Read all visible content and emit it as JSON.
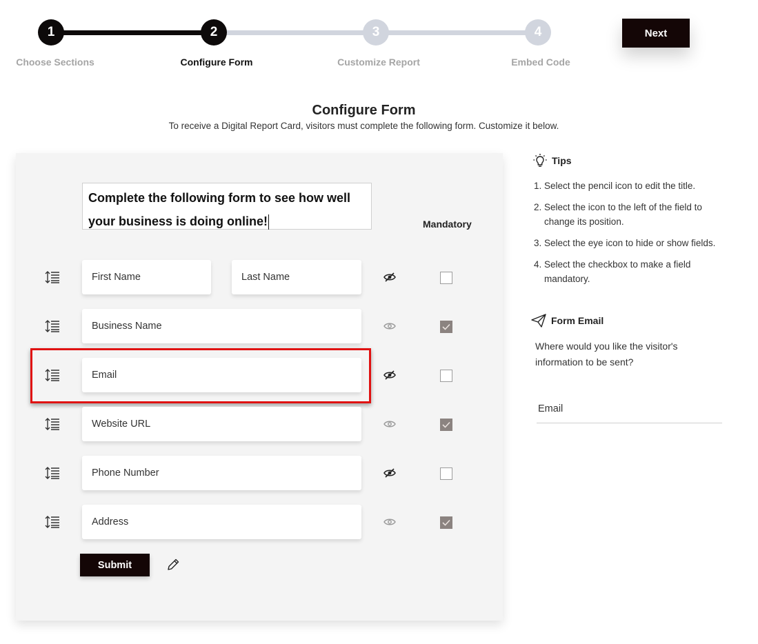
{
  "stepper": {
    "steps": [
      {
        "number": "1",
        "label": "Choose Sections",
        "state": "done"
      },
      {
        "number": "2",
        "label": "Configure Form",
        "state": "active"
      },
      {
        "number": "3",
        "label": "Customize Report",
        "state": "todo"
      },
      {
        "number": "4",
        "label": "Embed Code",
        "state": "todo"
      }
    ],
    "next_label": "Next"
  },
  "header": {
    "title": "Configure Form",
    "subtitle": "To receive a Digital Report Card, visitors must complete the following form. Customize it below."
  },
  "form": {
    "title_line1": "Complete the following form to see how well",
    "title_line2": "your business is doing online!",
    "mandatory_label": "Mandatory",
    "rows": [
      {
        "fields": [
          "First Name",
          "Last Name"
        ],
        "visible": false,
        "mandatory": false
      },
      {
        "fields": [
          "Business Name"
        ],
        "visible": true,
        "mandatory": true
      },
      {
        "fields": [
          "Email"
        ],
        "visible": false,
        "mandatory": false,
        "highlighted": true
      },
      {
        "fields": [
          "Website URL"
        ],
        "visible": true,
        "mandatory": true
      },
      {
        "fields": [
          "Phone Number"
        ],
        "visible": false,
        "mandatory": false
      },
      {
        "fields": [
          "Address"
        ],
        "visible": true,
        "mandatory": true
      }
    ],
    "submit_label": "Submit"
  },
  "tips": {
    "title": "Tips",
    "items": [
      "1. Select the pencil icon to edit the title.",
      "2. Select the icon to the left of the field to change its position.",
      "3. Select the eye icon to hide or show fields.",
      "4. Select the checkbox to make a field mandatory."
    ]
  },
  "form_email": {
    "title": "Form Email",
    "question": "Where would you like the visitor's information to be sent?",
    "value": "Email"
  },
  "colors": {
    "primary_dark": "#140606",
    "step_inactive": "#d1d5de",
    "highlight": "#e01212",
    "checked": "#8b8380"
  },
  "icons": [
    "lightbulb-icon",
    "paper-plane-icon",
    "drag-handle-icon",
    "eye-icon",
    "eye-slash-icon",
    "checkmark-icon",
    "pencil-icon"
  ]
}
